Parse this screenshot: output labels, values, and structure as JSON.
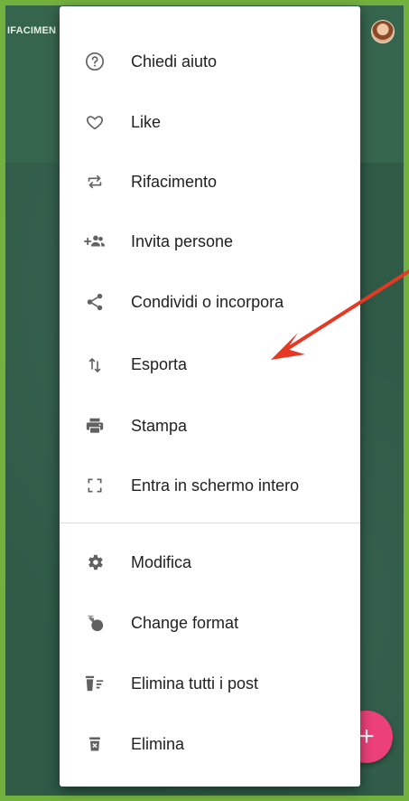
{
  "app": {
    "title": "IFACIMEN"
  },
  "menu": {
    "items": [
      {
        "id": "help",
        "label": "Chiedi aiuto",
        "icon": "help-circle-icon"
      },
      {
        "id": "like",
        "label": "Like",
        "icon": "heart-outline-icon"
      },
      {
        "id": "remake",
        "label": "Rifacimento",
        "icon": "remake-icon"
      },
      {
        "id": "invite",
        "label": "Invita persone",
        "icon": "add-people-icon"
      },
      {
        "id": "share",
        "label": "Condividi o incorpora",
        "icon": "share-icon"
      },
      {
        "id": "export",
        "label": "Esporta",
        "icon": "export-icon"
      },
      {
        "id": "print",
        "label": "Stampa",
        "icon": "printer-icon"
      },
      {
        "id": "fullscreen",
        "label": "Entra in schermo intero",
        "icon": "fullscreen-icon"
      },
      {
        "id": "modify",
        "label": "Modifica",
        "icon": "gear-icon"
      },
      {
        "id": "format",
        "label": "Change format",
        "icon": "shapes-icon"
      },
      {
        "id": "delete-posts",
        "label": "Elimina tutti i post",
        "icon": "clear-posts-icon"
      },
      {
        "id": "delete",
        "label": "Elimina",
        "icon": "trash-icon"
      }
    ]
  },
  "fab": {
    "label": "+"
  },
  "colors": {
    "frame": "#73b13f",
    "appbar": "#36654d",
    "board": "#2e5a46",
    "fab": "#ec407a",
    "annotation_arrow": "#e53925"
  }
}
